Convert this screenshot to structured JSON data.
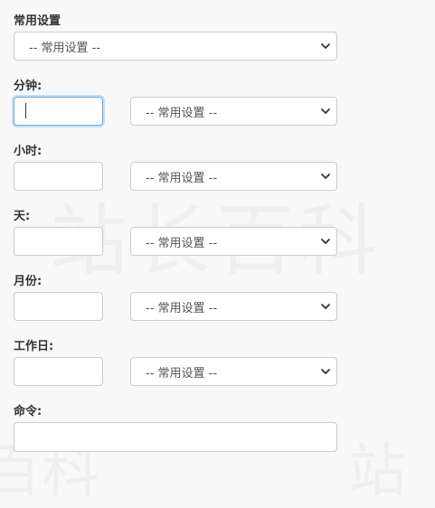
{
  "form": {
    "common": {
      "label": "常用设置",
      "select_value": "-- 常用设置 --"
    },
    "minute": {
      "label": "分钟:",
      "input_value": "",
      "select_value": "-- 常用设置 --"
    },
    "hour": {
      "label": "小时:",
      "input_value": "",
      "select_value": "-- 常用设置 --"
    },
    "day": {
      "label": "天:",
      "input_value": "",
      "select_value": "-- 常用设置 --"
    },
    "month": {
      "label": "月份:",
      "input_value": "",
      "select_value": "-- 常用设置 --"
    },
    "weekday": {
      "label": "工作日:",
      "input_value": "",
      "select_value": "-- 常用设置 --"
    },
    "command": {
      "label": "命令:",
      "input_value": ""
    }
  },
  "icons": {
    "select_arrow": "chevron-down-icon"
  },
  "colors": {
    "background": "#f8f8f8",
    "border": "#cccccc",
    "focus_border": "#66afe9",
    "label_text": "#333333"
  }
}
